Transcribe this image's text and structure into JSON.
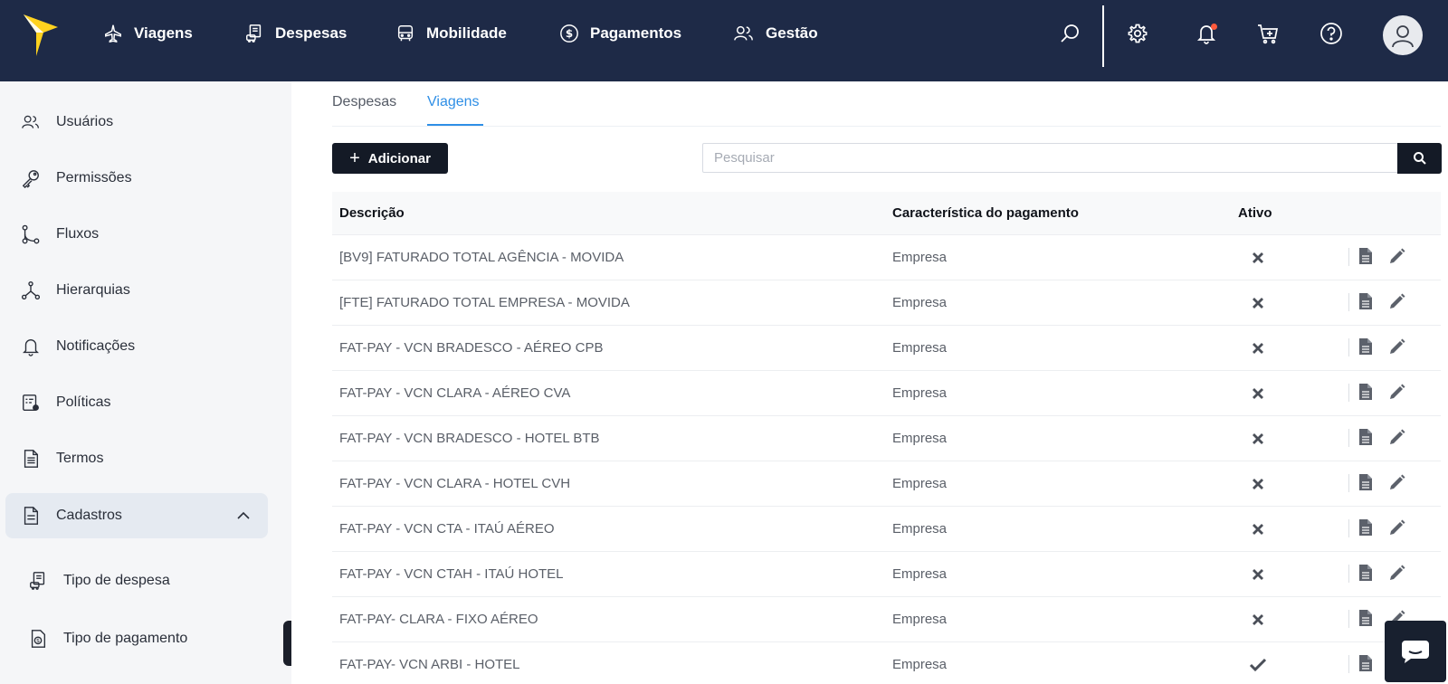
{
  "topnav": {
    "items": [
      {
        "label": "Viagens",
        "icon": "airplane-icon"
      },
      {
        "label": "Despesas",
        "icon": "receipt-car-icon"
      },
      {
        "label": "Mobilidade",
        "icon": "bus-icon"
      },
      {
        "label": "Pagamentos",
        "icon": "dollar-circle-icon"
      },
      {
        "label": "Gestão",
        "icon": "users-icon"
      }
    ],
    "icons": [
      "search-icon",
      "gear-icon",
      "bell-icon",
      "cart-plus-icon",
      "help-icon",
      "avatar"
    ],
    "colors": {
      "bar": "#1e2a47",
      "logo": "#ffd21f",
      "notification_dot": "#ff5a3c"
    }
  },
  "sidebar": {
    "items": [
      {
        "label": "Usuários",
        "icon": "users-icon"
      },
      {
        "label": "Permissões",
        "icon": "key-icon"
      },
      {
        "label": "Fluxos",
        "icon": "flow-icon"
      },
      {
        "label": "Hierarquias",
        "icon": "hierarchy-icon"
      },
      {
        "label": "Notificações",
        "icon": "bell-icon"
      },
      {
        "label": "Políticas",
        "icon": "policy-icon"
      },
      {
        "label": "Termos",
        "icon": "document-icon"
      },
      {
        "label": "Cadastros",
        "icon": "register-icon",
        "expanded": true
      }
    ],
    "subitems": [
      {
        "label": "Tipo de despesa",
        "icon": "expense-type-icon"
      },
      {
        "label": "Tipo de pagamento",
        "icon": "payment-type-icon"
      }
    ]
  },
  "main": {
    "tabs": [
      {
        "label": "Despesas",
        "active": false
      },
      {
        "label": "Viagens",
        "active": true
      }
    ],
    "add_label": "Adicionar",
    "search_placeholder": "Pesquisar",
    "table": {
      "columns": [
        "Descrição",
        "Característica do pagamento",
        "Ativo"
      ],
      "rows": [
        {
          "descricao": "[BV9] FATURADO TOTAL AGÊNCIA - MOVIDA",
          "caracteristica": "Empresa",
          "ativo": false
        },
        {
          "descricao": "[FTE] FATURADO TOTAL EMPRESA - MOVIDA",
          "caracteristica": "Empresa",
          "ativo": false
        },
        {
          "descricao": "FAT-PAY - VCN BRADESCO - AÉREO CPB",
          "caracteristica": "Empresa",
          "ativo": false
        },
        {
          "descricao": "FAT-PAY - VCN CLARA - AÉREO CVA",
          "caracteristica": "Empresa",
          "ativo": false
        },
        {
          "descricao": "FAT-PAY - VCN BRADESCO - HOTEL BTB",
          "caracteristica": "Empresa",
          "ativo": false
        },
        {
          "descricao": "FAT-PAY - VCN CLARA - HOTEL CVH",
          "caracteristica": "Empresa",
          "ativo": false
        },
        {
          "descricao": "FAT-PAY - VCN CTA - ITAÚ AÉREO",
          "caracteristica": "Empresa",
          "ativo": false
        },
        {
          "descricao": "FAT-PAY - VCN CTAH - ITAÚ HOTEL",
          "caracteristica": "Empresa",
          "ativo": false
        },
        {
          "descricao": "FAT-PAY- CLARA - FIXO AÉREO",
          "caracteristica": "Empresa",
          "ativo": false
        },
        {
          "descricao": "FAT-PAY- VCN ARBI - HOTEL",
          "caracteristica": "Empresa",
          "ativo": true
        }
      ]
    }
  },
  "accent_color": "#2f8fe6"
}
